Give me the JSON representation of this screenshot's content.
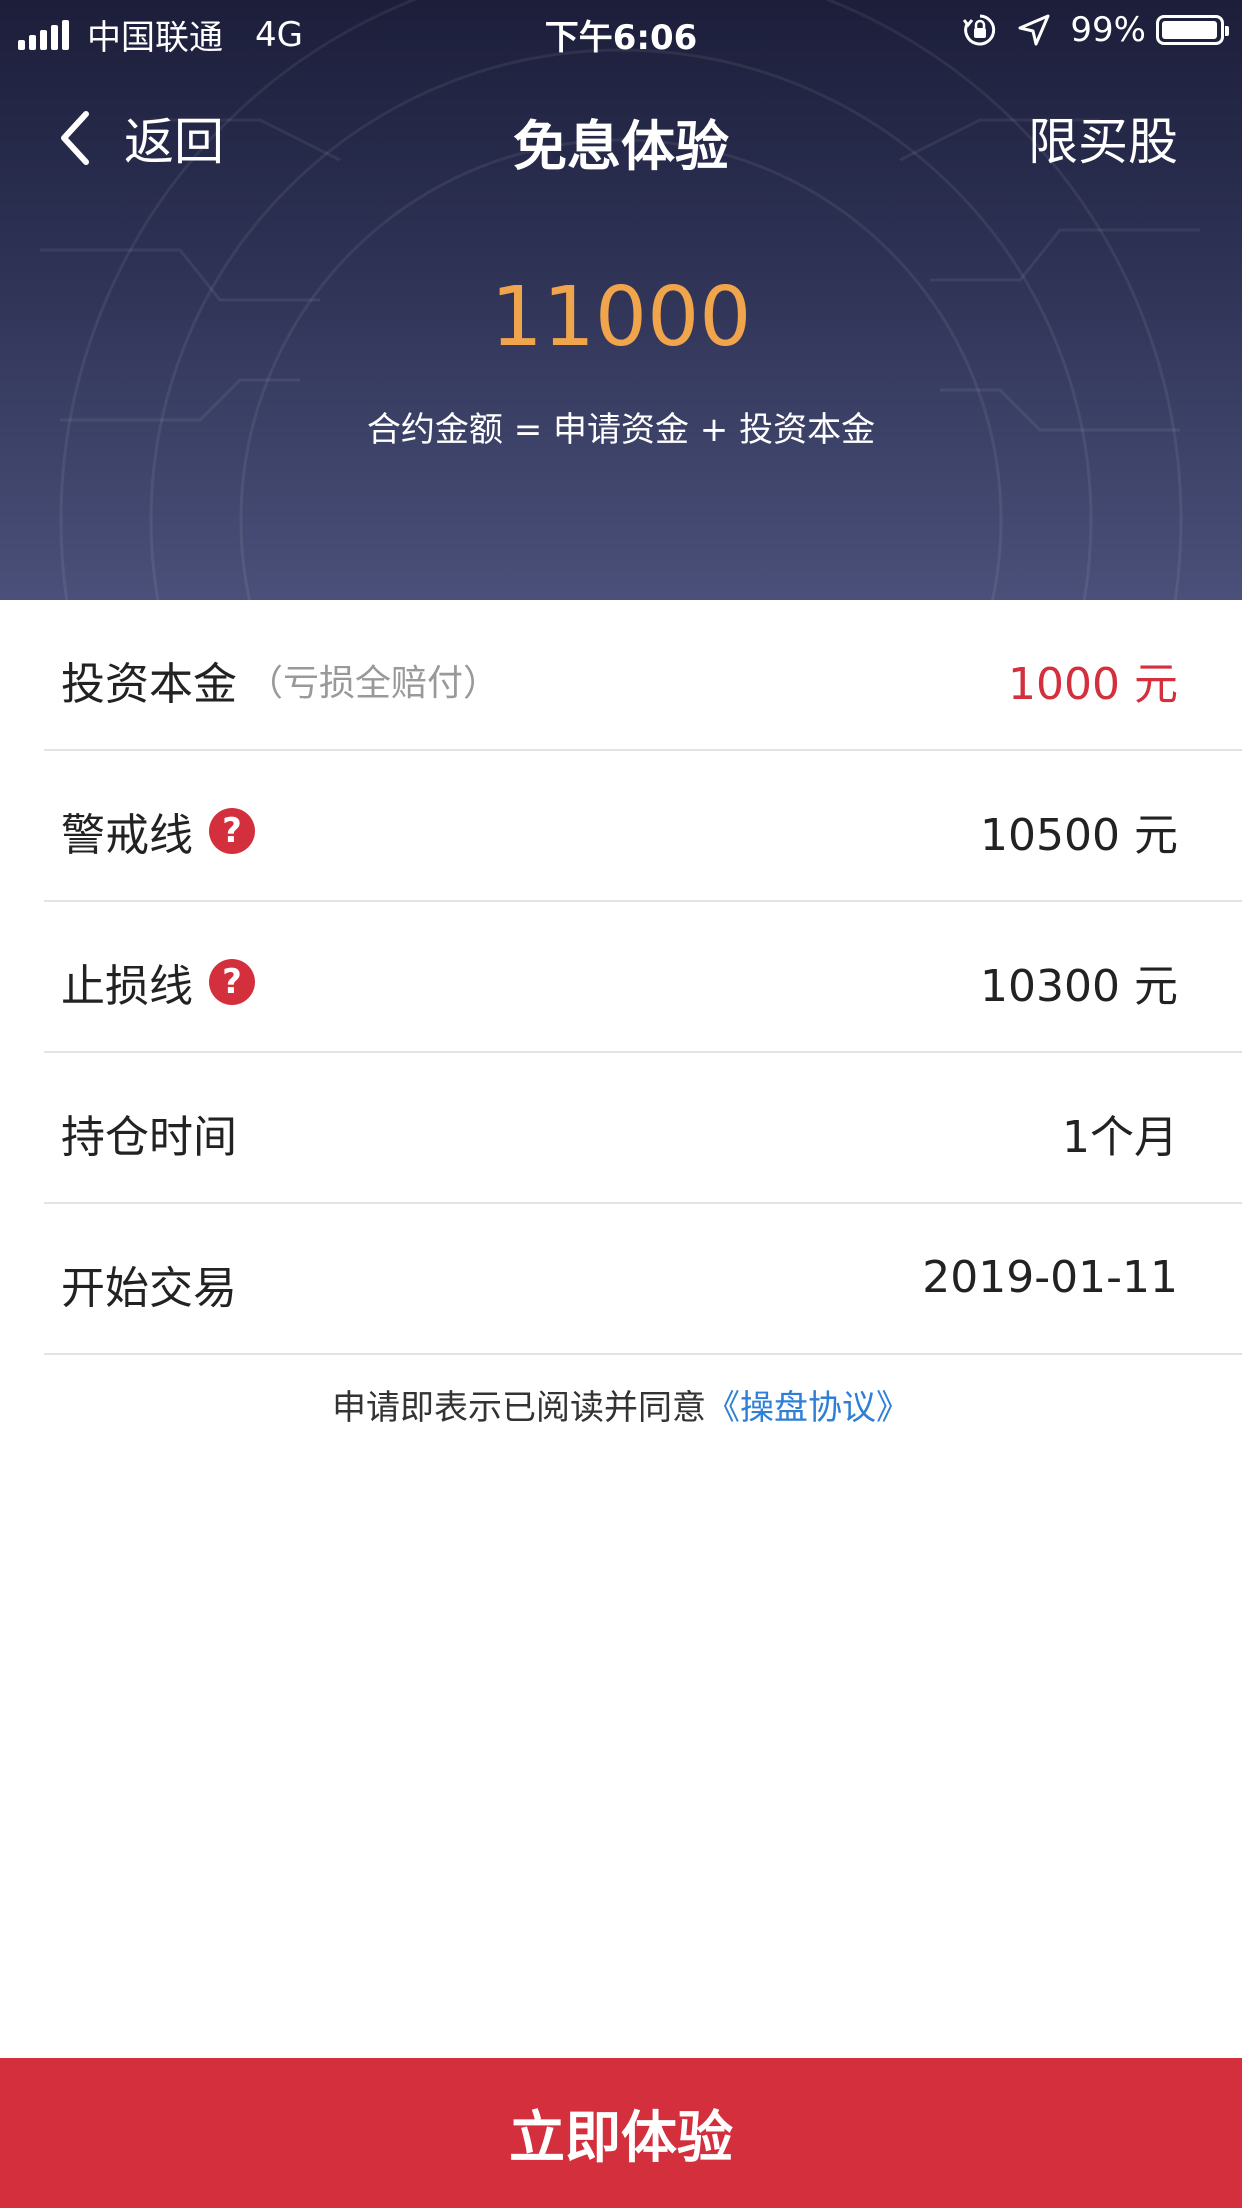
{
  "status_bar": {
    "carrier": "中国联通",
    "network": "4G",
    "time": "下午6:06",
    "battery": "99%",
    "icons": [
      "signal-icon",
      "rotation-lock-icon",
      "location-icon",
      "battery-icon"
    ]
  },
  "nav": {
    "back_label": "返回",
    "title": "免息体验",
    "right_label": "限买股"
  },
  "summary": {
    "amount": "11000",
    "formula": "合约金额 = 申请资金 + 投资本金"
  },
  "rows": [
    {
      "label": "投资本金",
      "hint": "（亏损全赔付）",
      "value": "1000 元"
    },
    {
      "label": "警戒线",
      "help": "?",
      "value": "10500 元"
    },
    {
      "label": "止损线",
      "help": "?",
      "value": "10300 元"
    },
    {
      "label": "持仓时间",
      "value": "1个月"
    },
    {
      "label": "开始交易",
      "value": "2019-01-11"
    }
  ],
  "agreement": {
    "text": "申请即表示已阅读并同意",
    "link": "《操盘协议》"
  },
  "cta_label": "立即体验",
  "colors": {
    "accent_red": "#d32f3c",
    "amount_orange": "#f0a44c",
    "link_blue": "#2f7fd6",
    "header_dark": "#1c1e3a"
  }
}
